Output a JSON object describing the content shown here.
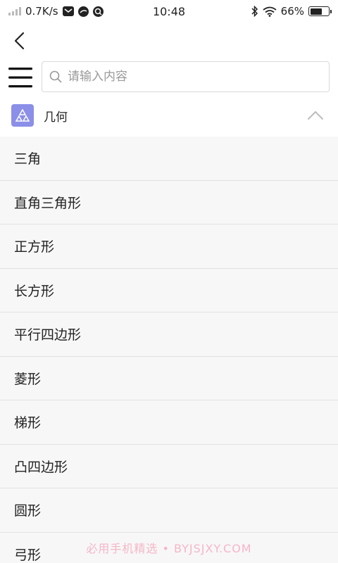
{
  "status_bar": {
    "network_speed": "0.7K/s",
    "time": "10:48",
    "battery_percent": "66%",
    "battery_level": 0.66
  },
  "nav": {
    "back_icon": "chevron-left-icon",
    "menu_icon": "hamburger-menu-icon"
  },
  "search": {
    "placeholder": "请输入内容",
    "value": ""
  },
  "category": {
    "label": "几何",
    "icon": "triangles-icon",
    "icon_color": "#8b8fe8",
    "expanded": true
  },
  "items": [
    {
      "label": "三角"
    },
    {
      "label": "直角三角形"
    },
    {
      "label": "正方形"
    },
    {
      "label": "长方形"
    },
    {
      "label": "平行四边形"
    },
    {
      "label": "菱形"
    },
    {
      "label": "梯形"
    },
    {
      "label": "凸四边形"
    },
    {
      "label": "圆形"
    },
    {
      "label": "弓形"
    }
  ],
  "watermark": "必用手机精选 • BYJSJXY.COM"
}
